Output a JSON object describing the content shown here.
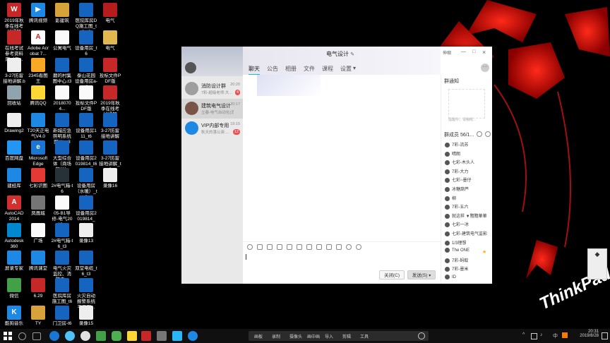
{
  "desktop": {
    "icons": [
      {
        "label": "2019年秋季在线考试通知",
        "color": "#c62828",
        "glyph": "W",
        "col": 0,
        "row": 0
      },
      {
        "label": "腾讯视频",
        "color": "#1e88e5",
        "glyph": "▶",
        "col": 1,
        "row": 0
      },
      {
        "label": "影建筑",
        "color": "#d7a23a",
        "glyph": "",
        "col": 2,
        "row": 0
      },
      {
        "label": "医院库房DQ施工图_t6_t3",
        "color": "#1565c0",
        "glyph": "",
        "col": 3,
        "row": 0
      },
      {
        "label": "电气",
        "color": "#b71c1c",
        "glyph": "",
        "col": 4,
        "row": 0
      },
      {
        "label": "在线考试参考资料库（仅...",
        "color": "#c62828",
        "glyph": "",
        "col": 0,
        "row": 1
      },
      {
        "label": "Adobe Acrobat 7...",
        "color": "#ffffff",
        "glyph": "A",
        "col": 1,
        "row": 1
      },
      {
        "label": "公寓电气",
        "color": "#fafafa",
        "glyph": "",
        "col": 2,
        "row": 1
      },
      {
        "label": "设备用房_t6",
        "color": "#1565c0",
        "glyph": "",
        "col": 3,
        "row": 1
      },
      {
        "label": "电气",
        "color": "#e0b84f",
        "glyph": "",
        "col": 4,
        "row": 1
      },
      {
        "label": "3-27防雷接地讲解.bak",
        "color": "#eeeeee",
        "glyph": "",
        "col": 0,
        "row": 2
      },
      {
        "label": "2345看图王",
        "color": "#f9a825",
        "glyph": "",
        "col": 1,
        "row": 2
      },
      {
        "label": "磨的村集图中心.t3",
        "color": "#1565c0",
        "glyph": "",
        "col": 2,
        "row": 2
      },
      {
        "label": "泰山花园设备用房a-t6",
        "color": "#1565c0",
        "glyph": "",
        "col": 3,
        "row": 2
      },
      {
        "label": "投标文件PDF版",
        "color": "#c62828",
        "glyph": "",
        "col": 4,
        "row": 2
      },
      {
        "label": "回收站",
        "color": "#90a4ae",
        "glyph": "",
        "col": 0,
        "row": 3
      },
      {
        "label": "腾讯QQ",
        "color": "#fdd835",
        "glyph": "",
        "col": 1,
        "row": 3
      },
      {
        "label": "20180704...",
        "color": "#fafafa",
        "glyph": "",
        "col": 2,
        "row": 3
      },
      {
        "label": "投标文件PDF版",
        "color": "#fafafa",
        "glyph": "",
        "col": 3,
        "row": 3
      },
      {
        "label": "2019年秋季在线考试通知",
        "color": "#c62828",
        "glyph": "",
        "col": 4,
        "row": 3
      },
      {
        "label": "Drawing2",
        "color": "#eeeeee",
        "glyph": "",
        "col": 0,
        "row": 4
      },
      {
        "label": "T20天正电气V4.0",
        "color": "#1e88e5",
        "glyph": "",
        "col": 1,
        "row": 4
      },
      {
        "label": "新城应急照明系统图(1)_t3",
        "color": "#1565c0",
        "glyph": "",
        "col": 2,
        "row": 4
      },
      {
        "label": "设备用房111_t6",
        "color": "#1565c0",
        "glyph": "",
        "col": 3,
        "row": 4
      },
      {
        "label": "3-27防雷接地讲解",
        "color": "#1565c0",
        "glyph": "",
        "col": 4,
        "row": 4
      },
      {
        "label": "百度网盘",
        "color": "#2196f3",
        "glyph": "",
        "col": 0,
        "row": 5
      },
      {
        "label": "Microsoft Edge",
        "color": "#1976d2",
        "glyph": "e",
        "col": 1,
        "row": 5
      },
      {
        "label": "大型综合体（商场部分）",
        "color": "#1565c0",
        "glyph": "",
        "col": 2,
        "row": 5
      },
      {
        "label": "设备用房2019814_t6",
        "color": "#1565c0",
        "glyph": "",
        "col": 3,
        "row": 5
      },
      {
        "label": "3-27防雷接地讲解_t3",
        "color": "#1565c0",
        "glyph": "",
        "col": 4,
        "row": 5
      },
      {
        "label": "建经库",
        "color": "#1e88e5",
        "glyph": "",
        "col": 0,
        "row": 6
      },
      {
        "label": "七彩识图",
        "color": "#e53935",
        "glyph": "",
        "col": 1,
        "row": 6
      },
      {
        "label": "2#电气箱-t6",
        "color": "#263238",
        "glyph": "",
        "col": 2,
        "row": 6
      },
      {
        "label": "设备用房（水暖）_t3",
        "color": "#1565c0",
        "glyph": "",
        "col": 3,
        "row": 6
      },
      {
        "label": "录像16",
        "color": "#eeeeee",
        "glyph": "",
        "col": 4,
        "row": 6
      },
      {
        "label": "AutoCAD 2014",
        "color": "#d32f2f",
        "glyph": "A",
        "col": 0,
        "row": 7
      },
      {
        "label": "凤凰城",
        "color": "#757575",
        "glyph": "",
        "col": 1,
        "row": 7
      },
      {
        "label": "05-B1导修-电气2019...",
        "color": "#fafafa",
        "glyph": "",
        "col": 2,
        "row": 7
      },
      {
        "label": "设备用房2019814_t...",
        "color": "#1565c0",
        "glyph": "",
        "col": 3,
        "row": 7
      },
      {
        "label": "",
        "color": "#000000",
        "glyph": "",
        "col": 4,
        "row": 7
      },
      {
        "label": "Autodesk 360",
        "color": "#0288d1",
        "glyph": "",
        "col": 0,
        "row": 8
      },
      {
        "label": "广场",
        "color": "#fafafa",
        "glyph": "",
        "col": 1,
        "row": 8
      },
      {
        "label": "2#电气箱-t6_t3",
        "color": "#1565c0",
        "glyph": "",
        "col": 2,
        "row": 8
      },
      {
        "label": "录像13",
        "color": "#eeeeee",
        "glyph": "",
        "col": 3,
        "row": 8
      },
      {
        "label": "",
        "color": "#000000",
        "glyph": "",
        "col": 4,
        "row": 8
      },
      {
        "label": "屏录专家",
        "color": "#1e88e5",
        "glyph": "",
        "col": 0,
        "row": 9
      },
      {
        "label": "腾讯课堂",
        "color": "#1e88e5",
        "glyph": "",
        "col": 1,
        "row": 9
      },
      {
        "label": "电气火灾监控、消防电...",
        "color": "#1565c0",
        "glyph": "",
        "col": 2,
        "row": 9
      },
      {
        "label": "双堂电缆_t6_t3",
        "color": "#1565c0",
        "glyph": "",
        "col": 3,
        "row": 9
      },
      {
        "label": "",
        "color": "#000000",
        "glyph": "",
        "col": 4,
        "row": 9
      },
      {
        "label": "微信",
        "color": "#43a047",
        "glyph": "",
        "col": 0,
        "row": 10
      },
      {
        "label": "6.29",
        "color": "#c62828",
        "glyph": "",
        "col": 1,
        "row": 10
      },
      {
        "label": "医院库房施工图_t6",
        "color": "#1565c0",
        "glyph": "",
        "col": 2,
        "row": 10
      },
      {
        "label": "火灾自动报警系统平面图...",
        "color": "#1565c0",
        "glyph": "",
        "col": 3,
        "row": 10
      },
      {
        "label": "",
        "color": "#000000",
        "glyph": "",
        "col": 4,
        "row": 10
      },
      {
        "label": "酷狗音乐",
        "color": "#1e88e5",
        "glyph": "K",
        "col": 0,
        "row": 11
      },
      {
        "label": "TY",
        "color": "#d7a23a",
        "glyph": "",
        "col": 1,
        "row": 11
      },
      {
        "label": "门卫房-t6",
        "color": "#1565c0",
        "glyph": "",
        "col": 2,
        "row": 11
      },
      {
        "label": "录像15",
        "color": "#eeeeee",
        "glyph": "",
        "col": 3,
        "row": 11
      },
      {
        "label": "",
        "color": "#000000",
        "glyph": "",
        "col": 4,
        "row": 11
      }
    ],
    "brand": "ThinkPad"
  },
  "chat": {
    "title": "电气设计",
    "window_controls": {
      "mini": "—",
      "max": "□",
      "close": "×",
      "extra": "伸缩"
    },
    "tabs": [
      "聊天",
      "公告",
      "相册",
      "文件",
      "课程",
      "设置"
    ],
    "active_tab": "聊天",
    "sessions": [
      {
        "name": "消防设计群",
        "time": "20:20",
        "preview": "7彩-超级老师:大...",
        "badge": "4",
        "color": "#9e9e9e"
      },
      {
        "name": "建筑电气设计",
        "time": "20:17",
        "preview": "立春-电气自动化(消...",
        "badge": "",
        "color": "#795548"
      },
      {
        "name": "VIP内部专用",
        "time": "19:15",
        "preview": "秋天的落公英:...",
        "badge": "12",
        "color": "#1e88e5"
      }
    ],
    "group_notice": {
      "title": "群通知",
      "empty_text": "提醒中，请稍候..."
    },
    "members": {
      "title": "群成员 56/1...",
      "list": [
        "7彩-流苏",
        "晴朗",
        "七彩-木头人",
        "7彩-大力",
        "七彩~墨仔",
        "冰糖葫芦",
        "柳",
        "7彩-五六",
        "就这样 ▼黯黯華華",
        "七彩一冰",
        "七彩-建筑电气监影",
        "1/3理想",
        "The ONE",
        "7彩-蚂蚁",
        "7彩-墨米",
        "ID"
      ]
    },
    "buttons": {
      "close": "关闭(C)",
      "send": "发送(S)"
    }
  },
  "taskbar": {
    "time": "20:31",
    "date": "2019/8/28",
    "tray_text": "中",
    "toolbar": [
      "画板",
      "录制",
      "摄像头",
      "画中画",
      "导入",
      "剪辑",
      "工具"
    ]
  }
}
